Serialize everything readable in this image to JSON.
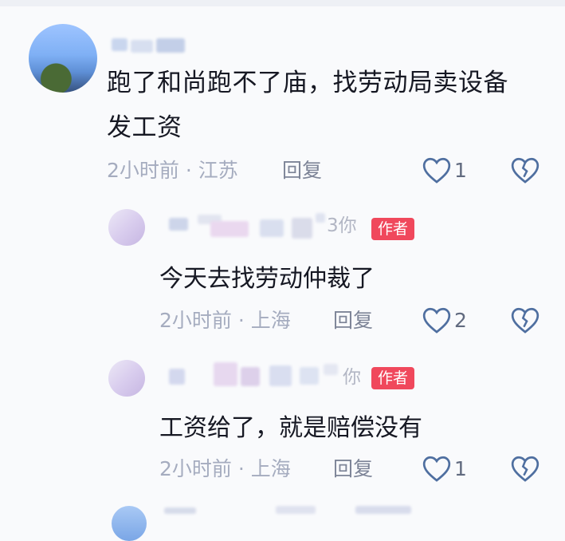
{
  "comment": {
    "username_visible": "...",
    "text": "跑了和尚跑不了庙，找劳动局卖设备",
    "text_line2": "发工资",
    "time": "2小时前",
    "location": "江苏",
    "reply_label": "回复",
    "likes": "1"
  },
  "replies": [
    {
      "name_tail": "3你",
      "badge": "作者",
      "text": "今天去找劳动仲裁了",
      "time": "2小时前",
      "location": "上海",
      "reply_label": "回复",
      "likes": "2"
    },
    {
      "name_tail": "你",
      "badge": "作者",
      "text": "工资给了，就是赔偿没有",
      "time": "2小时前",
      "location": "上海",
      "reply_label": "回复",
      "likes": "1"
    }
  ],
  "icons": {
    "like": "heart-outline-icon",
    "dislike": "broken-heart-icon"
  },
  "colors": {
    "accent": "#f0485c",
    "meta_gray": "#a5acbf",
    "icon_blue": "#4f6fa0"
  }
}
